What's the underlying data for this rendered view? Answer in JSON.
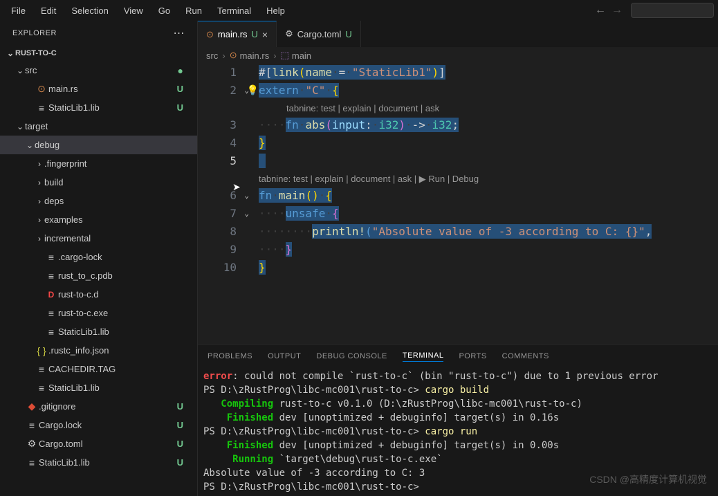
{
  "menubar": [
    "File",
    "Edit",
    "Selection",
    "View",
    "Go",
    "Run",
    "Terminal",
    "Help"
  ],
  "explorer": {
    "title": "EXPLORER",
    "project": "RUST-TO-C",
    "tree": [
      {
        "depth": 1,
        "chev": "down",
        "label": "src",
        "badge": "",
        "dot": true
      },
      {
        "depth": 2,
        "icon": "rust",
        "label": "main.rs",
        "badge": "U",
        "active": true
      },
      {
        "depth": 2,
        "icon": "file",
        "label": "StaticLib1.lib",
        "badge": "U"
      },
      {
        "depth": 1,
        "chev": "down",
        "label": "target"
      },
      {
        "depth": 2,
        "chev": "down",
        "label": "debug",
        "selected": true
      },
      {
        "depth": 3,
        "chev": "right",
        "label": ".fingerprint"
      },
      {
        "depth": 3,
        "chev": "right",
        "label": "build"
      },
      {
        "depth": 3,
        "chev": "right",
        "label": "deps"
      },
      {
        "depth": 3,
        "chev": "right",
        "label": "examples"
      },
      {
        "depth": 3,
        "chev": "right",
        "label": "incremental"
      },
      {
        "depth": 3,
        "icon": "file",
        "label": ".cargo-lock"
      },
      {
        "depth": 3,
        "icon": "file",
        "label": "rust_to_c.pdb"
      },
      {
        "depth": 3,
        "icon": "d",
        "label": "rust-to-c.d"
      },
      {
        "depth": 3,
        "icon": "file",
        "label": "rust-to-c.exe"
      },
      {
        "depth": 3,
        "icon": "file",
        "label": "StaticLib1.lib"
      },
      {
        "depth": 2,
        "icon": "json",
        "label": ".rustc_info.json"
      },
      {
        "depth": 2,
        "icon": "file",
        "label": "CACHEDIR.TAG"
      },
      {
        "depth": 2,
        "icon": "file",
        "label": "StaticLib1.lib"
      },
      {
        "depth": 1,
        "icon": "git",
        "label": ".gitignore",
        "badge": "U"
      },
      {
        "depth": 1,
        "icon": "file",
        "label": "Cargo.lock",
        "badge": "U"
      },
      {
        "depth": 1,
        "icon": "gear",
        "label": "Cargo.toml",
        "badge": "U"
      },
      {
        "depth": 1,
        "icon": "file",
        "label": "StaticLib1.lib",
        "badge": "U"
      }
    ]
  },
  "tabs": [
    {
      "icon": "rust",
      "label": "main.rs",
      "mod": "U",
      "active": true,
      "close": true
    },
    {
      "icon": "gear",
      "label": "Cargo.toml",
      "mod": "U",
      "active": false
    }
  ],
  "breadcrumbs": [
    "src",
    "main.rs",
    "main"
  ],
  "codelens1": "tabnine: test | explain | document | ask",
  "codelens2": "tabnine: test | explain | document | ask | ▶ Run | Debug",
  "code": {
    "l1_link": "link",
    "l1_name": "name",
    "l1_str": "\"StaticLib1\"",
    "l2_extern": "extern",
    "l2_c": "\"C\"",
    "l3_fn": "fn",
    "l3_abs": "abs",
    "l3_input": "input",
    "l3_i32a": "i32",
    "l3_i32b": "i32",
    "l6_fn": "fn",
    "l6_main": "main",
    "l7_unsafe": "unsafe",
    "l8_println": "println!",
    "l8_str": "\"Absolute value of -3 according to C: {}\""
  },
  "panel": {
    "tabs": [
      "PROBLEMS",
      "OUTPUT",
      "DEBUG CONSOLE",
      "TERMINAL",
      "PORTS",
      "COMMENTS"
    ],
    "active": 3
  },
  "terminal": {
    "l1a": "error",
    "l1b": ": could not compile `rust-to-c` (bin \"rust-to-c\") due to 1 previous error",
    "l2a": "PS D:\\zRustProg\\libc-mc001\\rust-to-c> ",
    "l2b": "cargo build",
    "l3a": "   Compiling",
    "l3b": " rust-to-c v0.1.0 (D:\\zRustProg\\libc-mc001\\rust-to-c)",
    "l4a": "    Finished",
    "l4b": " dev [unoptimized + debuginfo] target(s) in 0.16s",
    "l5a": "PS D:\\zRustProg\\libc-mc001\\rust-to-c> ",
    "l5b": "cargo run",
    "l6a": "    Finished",
    "l6b": " dev [unoptimized + debuginfo] target(s) in 0.00s",
    "l7a": "     Running",
    "l7b": " `target\\debug\\rust-to-c.exe`",
    "l8": "Absolute value of -3 according to C: 3",
    "l9": "PS D:\\zRustProg\\libc-mc001\\rust-to-c>"
  },
  "watermark": "CSDN @高精度计算机视觉"
}
